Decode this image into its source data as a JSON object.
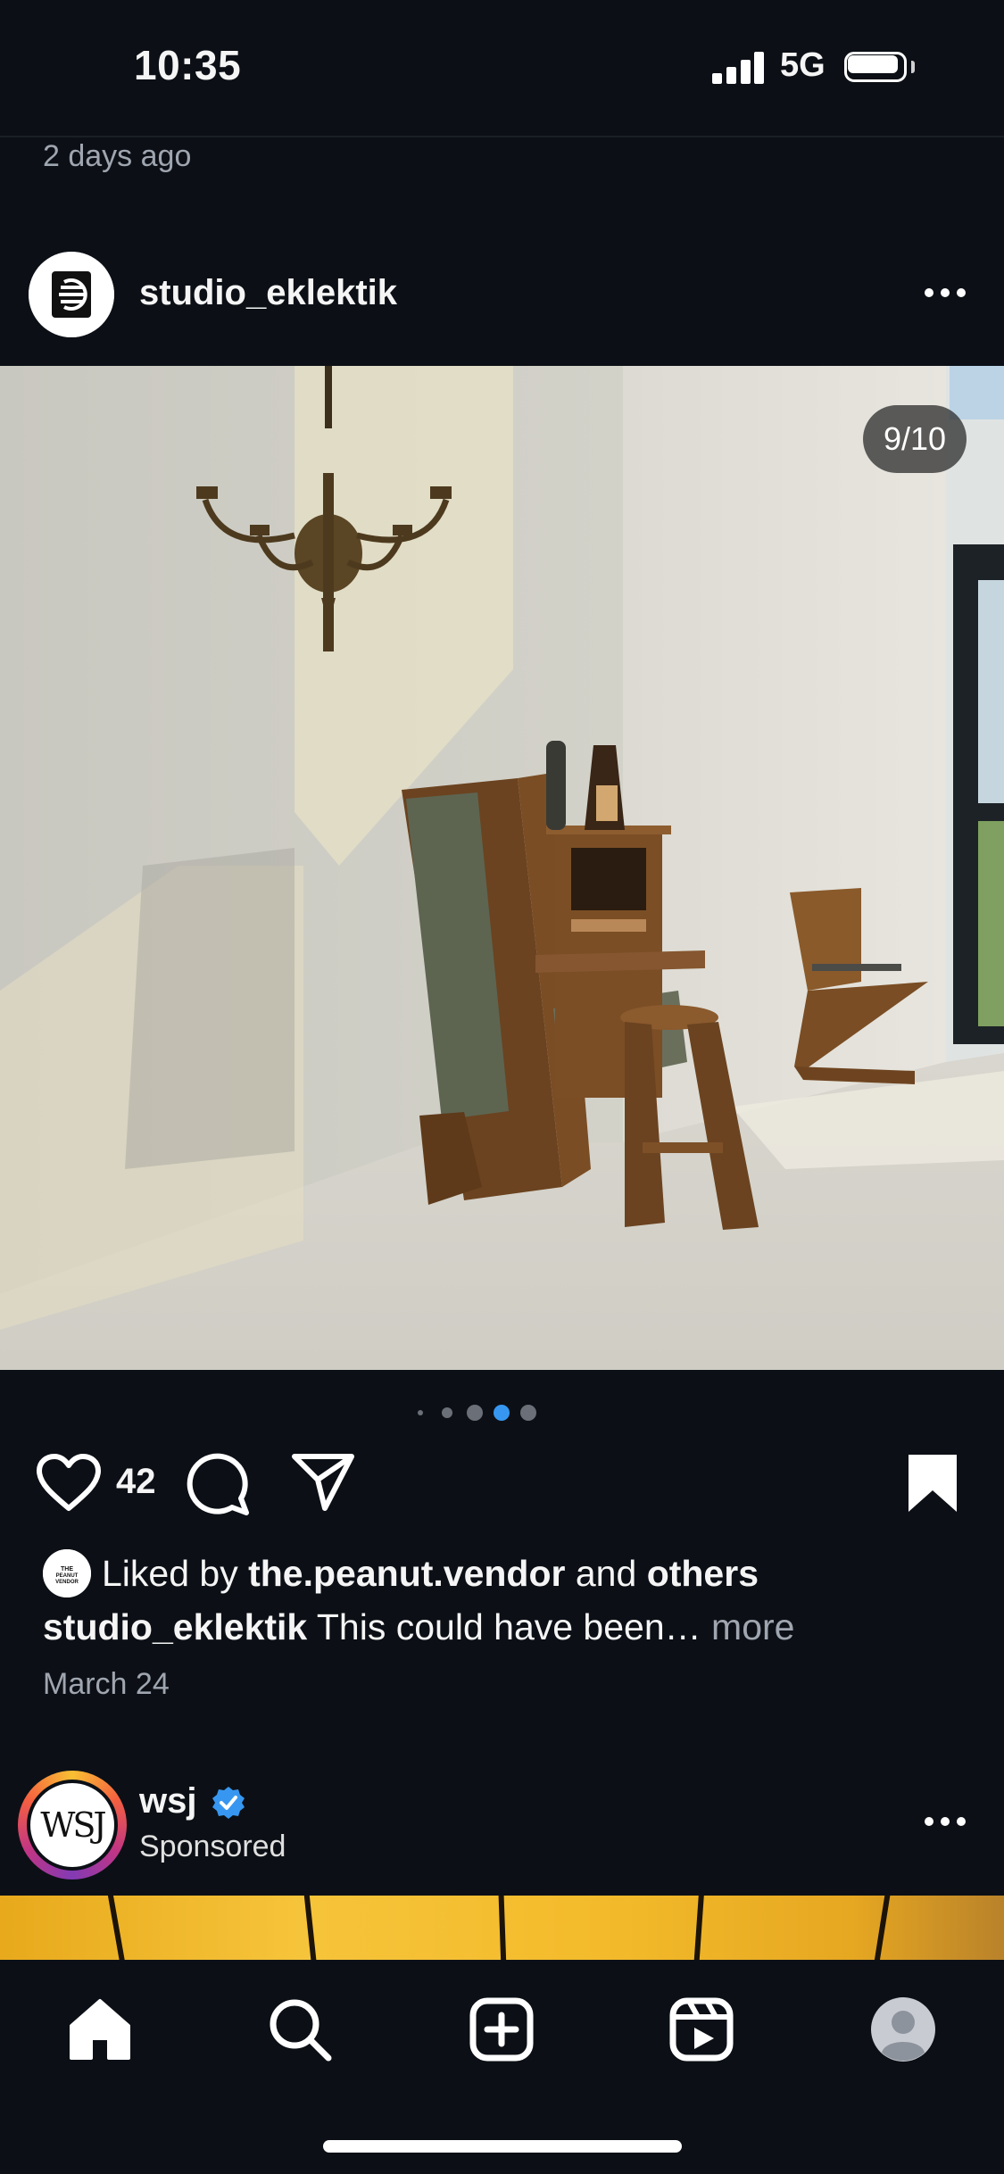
{
  "status_bar": {
    "time": "10:35",
    "network": "5G"
  },
  "previous_post": {
    "timestamp": "2 days ago"
  },
  "post": {
    "username": "studio_eklektik",
    "photo_counter": "9/10",
    "like_count": "42",
    "liked_by_prefix": "Liked by ",
    "liked_by_user": "the.peanut.vendor",
    "liked_by_and": " and ",
    "liked_by_others": "others",
    "caption_user": "studio_eklektik",
    "caption_text": " This could have been…",
    "caption_more": " more",
    "date": "March 24",
    "liker_avatar_text": "THE PEANUT VENDOR"
  },
  "sponsored_post": {
    "username": "wsj",
    "label": "Sponsored",
    "avatar_text": "WSJ"
  },
  "tab_bar": {
    "items": [
      {
        "icon": "home-icon"
      },
      {
        "icon": "search-icon"
      },
      {
        "icon": "create-post-icon"
      },
      {
        "icon": "reels-icon"
      },
      {
        "icon": "profile-avatar"
      }
    ]
  },
  "colors": {
    "background": "#0c1016",
    "active_dot": "#3797f0",
    "verified": "#3797f0",
    "muted_text": "#a0a6b0"
  }
}
